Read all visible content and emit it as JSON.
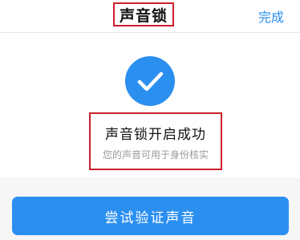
{
  "header": {
    "title": "声音锁",
    "done_label": "完成"
  },
  "result": {
    "icon": "check-circle-icon",
    "title": "声音锁开启成功",
    "subtitle": "您的声音可用于身份核实"
  },
  "actions": {
    "try_label": "尝试验证声音"
  },
  "colors": {
    "accent": "#2b8ff0",
    "highlight_border": "#cc1f2b"
  }
}
